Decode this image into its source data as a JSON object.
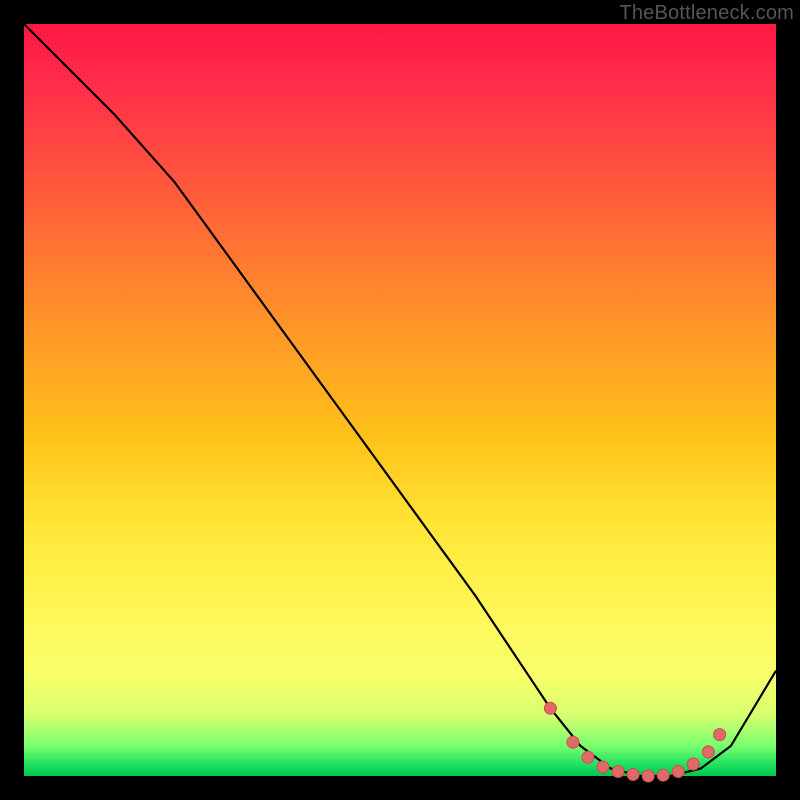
{
  "watermark": "TheBottleneck.com",
  "colors": {
    "frame": "#000000",
    "curve": "#000000",
    "marker_fill": "#e06a6a",
    "marker_stroke": "#c94f4f",
    "gradient_top": "#ff1744",
    "gradient_bottom": "#00c84c"
  },
  "chart_data": {
    "type": "line",
    "title": "",
    "xlabel": "",
    "ylabel": "",
    "xlim": [
      0,
      100
    ],
    "ylim": [
      0,
      100
    ],
    "series": [
      {
        "name": "bottleneck-curve",
        "x": [
          0,
          6,
          12,
          20,
          28,
          36,
          44,
          52,
          60,
          66,
          70,
          74,
          78,
          82,
          86,
          90,
          94,
          100
        ],
        "y": [
          100,
          94,
          88,
          79,
          68,
          57,
          46,
          35,
          24,
          15,
          9,
          4,
          1,
          0,
          0,
          1,
          4,
          14
        ]
      }
    ],
    "markers": {
      "series": "bottleneck-curve",
      "points": [
        {
          "x": 70,
          "y": 9
        },
        {
          "x": 73,
          "y": 4.5
        },
        {
          "x": 75,
          "y": 2.5
        },
        {
          "x": 77,
          "y": 1.2
        },
        {
          "x": 79,
          "y": 0.6
        },
        {
          "x": 81,
          "y": 0.2
        },
        {
          "x": 83,
          "y": 0.0
        },
        {
          "x": 85,
          "y": 0.1
        },
        {
          "x": 87,
          "y": 0.6
        },
        {
          "x": 89,
          "y": 1.6
        },
        {
          "x": 91,
          "y": 3.2
        },
        {
          "x": 92.5,
          "y": 5.5
        }
      ]
    }
  }
}
